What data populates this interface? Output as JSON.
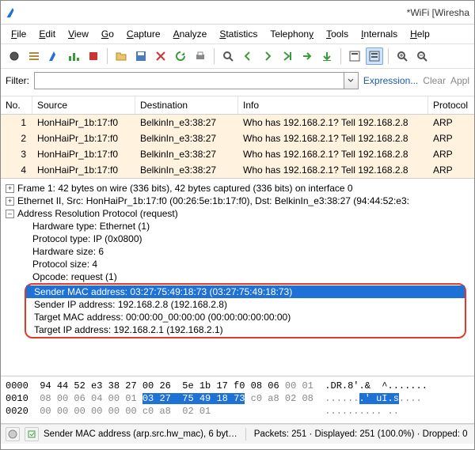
{
  "title": "*WiFi   [Wiresha",
  "menu": [
    "File",
    "Edit",
    "View",
    "Go",
    "Capture",
    "Analyze",
    "Statistics",
    "Telephony",
    "Tools",
    "Internals",
    "Help"
  ],
  "filter": {
    "label": "Filter:",
    "value": "",
    "placeholder": "",
    "links": [
      "Expression...",
      "Clear",
      "Appl"
    ]
  },
  "columns": [
    "No.",
    "Source",
    "Destination",
    "Info",
    "Protocol"
  ],
  "packets": [
    {
      "no": "1",
      "src": "HonHaiPr_1b:17:f0",
      "dst": "BelkinIn_e3:38:27",
      "info": "Who has 192.168.2.1?  Tell 192.168.2.8",
      "proto": "ARP"
    },
    {
      "no": "2",
      "src": "HonHaiPr_1b:17:f0",
      "dst": "BelkinIn_e3:38:27",
      "info": "Who has 192.168.2.1?  Tell 192.168.2.8",
      "proto": "ARP"
    },
    {
      "no": "3",
      "src": "HonHaiPr_1b:17:f0",
      "dst": "BelkinIn_e3:38:27",
      "info": "Who has 192.168.2.1?  Tell 192.168.2.8",
      "proto": "ARP"
    },
    {
      "no": "4",
      "src": "HonHaiPr_1b:17:f0",
      "dst": "BelkinIn_e3:38:27",
      "info": "Who has 192.168.2.1?  Tell 192.168.2.8",
      "proto": "ARP"
    }
  ],
  "details": {
    "frame": "Frame 1: 42 bytes on wire (336 bits), 42 bytes captured (336 bits) on interface 0",
    "eth": "Ethernet II, Src: HonHaiPr_1b:17:f0 (00:26:5e:1b:17:f0), Dst: BelkinIn_e3:38:27 (94:44:52:e3:",
    "arp": "Address Resolution Protocol (request)",
    "fields": {
      "hwtype": "Hardware type: Ethernet (1)",
      "ptype": "Protocol type: IP (0x0800)",
      "hwsize": "Hardware size: 6",
      "psize": "Protocol size: 4",
      "opcode": "Opcode: request (1)",
      "smac": "Sender MAC address: 03:27:75:49:18:73 (03:27:75:49:18:73)",
      "sip": "Sender IP address: 192.168.2.8 (192.168.2.8)",
      "tmac": "Target MAC address: 00:00:00_00:00:00 (00:00:00:00:00:00)",
      "tip": "Target IP address: 192.168.2.1 (192.168.2.1)"
    }
  },
  "hex": {
    "l0_off": "0000",
    "l0_a": "94 44 52 e3 38 27 00 26  5e 1b 17 f0 08 06 ",
    "l0_b": "00 01",
    "l0_asc": "  .DR.8'.&  ^.......",
    "l1_off": "0010",
    "l1_a": "08 00 06 04 00 01 ",
    "l1_hl": "03 27  75 49 18 73",
    "l1_b": " c0 a8 02 08",
    "l1_asc": "  ......",
    "l1_asc_hl": ".' uI.s",
    "l1_asc_b": "....",
    "l2_off": "0020",
    "l2_a": "00 00 00 00 00 00 c0 a8  02 01",
    "l2_asc": "                    .......... .."
  },
  "status": {
    "field": "Sender MAC address (arp.src.hw_mac), 6 byt…",
    "packets": "Packets: 251 · Displayed: 251 (100.0%) · Dropped: 0"
  },
  "toolbar_icons": [
    "record-icon",
    "list-icon",
    "shark-icon",
    "stats-icon",
    "stop-icon",
    "open-icon",
    "save-icon",
    "close-icon",
    "refresh-icon",
    "print-icon",
    "search-icon",
    "back-icon",
    "forward-icon",
    "jump-icon",
    "go-icon",
    "down-icon",
    "view-list-icon",
    "view-detail-icon",
    "zoom-in-icon",
    "zoom-out-icon"
  ],
  "colors": {
    "accent": "#1e71d6",
    "packet_bg": "#fff2df",
    "highlight_border": "#e03a2a"
  }
}
